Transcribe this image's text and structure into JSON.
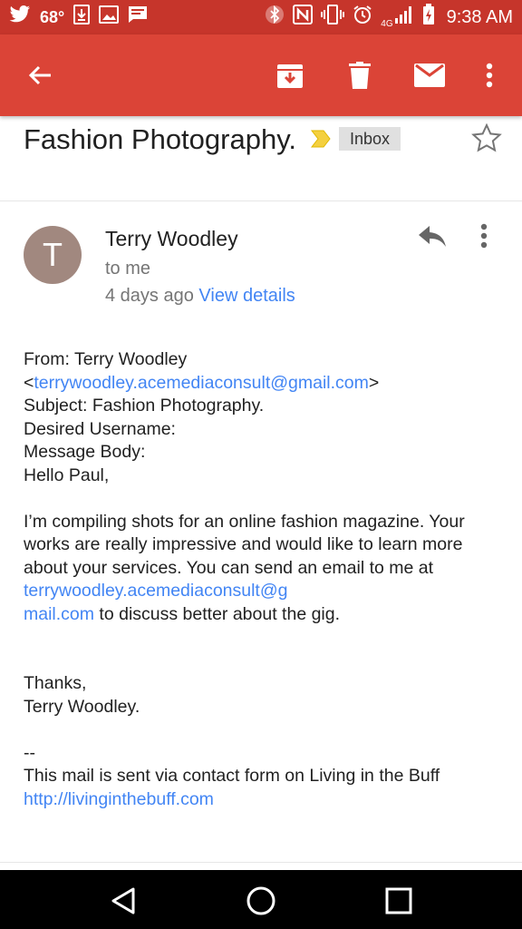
{
  "status_bar": {
    "temperature": "68°",
    "network_label": "4G",
    "time": "9:38 AM",
    "icons_left": [
      "twitter-icon",
      "download-icon",
      "image-icon",
      "message-icon"
    ],
    "icons_right": [
      "bluetooth-icon",
      "nfc-icon",
      "vibrate-icon",
      "alarm-icon",
      "signal-icon",
      "battery-icon"
    ]
  },
  "app_bar": {
    "back_icon": "arrow-back-icon",
    "actions": [
      "archive-icon",
      "delete-icon",
      "mark-unread-icon",
      "more-vert-icon"
    ],
    "background_color": "#db4437"
  },
  "email": {
    "subject": "Fashion Photography.",
    "label": "Inbox",
    "sender": {
      "initial": "T",
      "name": "Terry Woodley",
      "to": "to me",
      "date": "4 days ago",
      "view_details": "View details",
      "avatar_color": "#a1887f"
    },
    "body": {
      "from_label": "From: Terry Woodley",
      "from_email_open": "<",
      "from_email": "terrywoodley.acemediaconsult@gmail.com",
      "from_email_close": ">",
      "subject_line": "Subject: Fashion Photography.",
      "desired_username": "Desired Username:",
      "message_body": "Message Body:",
      "greeting": "Hello Paul,",
      "paragraph_1": "I’m compiling shots for an online fashion magazine. Your works are really impressive and would like to learn more about your services. You can send an email to me at ",
      "paragraph_email_1": "terrywoodley.acemediaconsult@g",
      "paragraph_email_2": "mail.com",
      "paragraph_end": " to discuss better about the gig.",
      "thanks": "Thanks,",
      "signature": "Terry Woodley.",
      "separator": "--",
      "footer": "This mail is sent via contact form on Living in the Buff",
      "footer_link": "http://livinginthebuff.com"
    },
    "link_color": "#4285f4"
  },
  "nav_bar": {
    "buttons": [
      "back-nav-icon",
      "home-nav-icon",
      "recents-nav-icon"
    ]
  }
}
